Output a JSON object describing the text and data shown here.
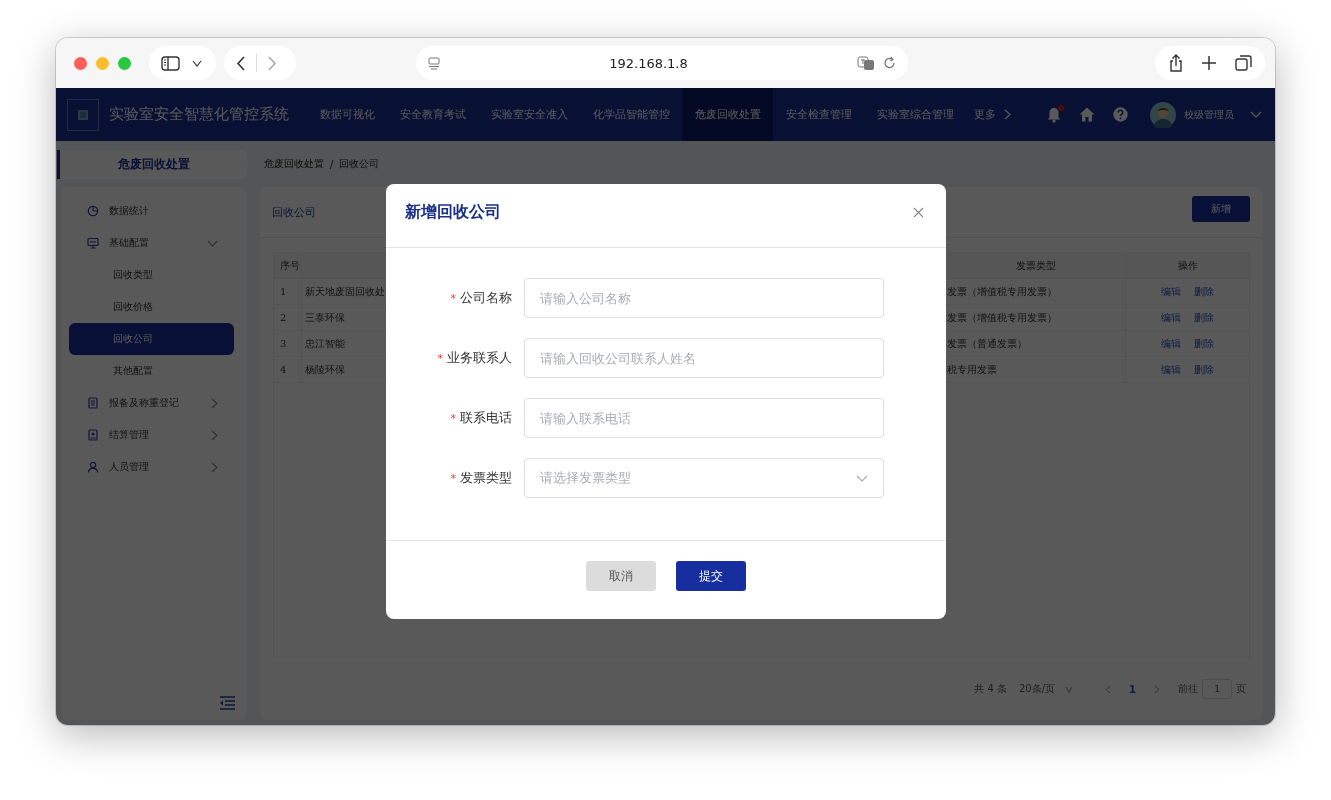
{
  "browser": {
    "address": "192.168.1.8"
  },
  "app": {
    "title": "实验室安全智慧化管控系统",
    "nav": [
      {
        "label": "数据可视化",
        "selected": false
      },
      {
        "label": "安全教育考试",
        "selected": false
      },
      {
        "label": "实验室安全准入",
        "selected": false
      },
      {
        "label": "化学品智能管控",
        "selected": false
      },
      {
        "label": "危废回收处置",
        "selected": true
      },
      {
        "label": "安全检查管理",
        "selected": false
      },
      {
        "label": "实验室综合管理",
        "selected": false
      }
    ],
    "more": "更多",
    "user": "校级管理员"
  },
  "sidebar": {
    "section_title": "危废回收处置",
    "items": [
      {
        "label": "数据统计"
      },
      {
        "label": "基础配置",
        "expanded": true,
        "children": [
          {
            "label": "回收类型",
            "selected": false
          },
          {
            "label": "回收价格",
            "selected": false
          },
          {
            "label": "回收公司",
            "selected": true
          },
          {
            "label": "其他配置",
            "selected": false
          }
        ]
      },
      {
        "label": "报备及称重登记",
        "expanded": false
      },
      {
        "label": "结算管理",
        "expanded": false
      },
      {
        "label": "人员管理",
        "expanded": false
      }
    ]
  },
  "breadcrumb": {
    "items": [
      "危废回收处置",
      "回收公司"
    ],
    "separator": "/"
  },
  "panel": {
    "title": "回收公司",
    "add_button": "新增",
    "table": {
      "header": {
        "index": "序号",
        "invoice_type": "发票类型",
        "actions": "操作"
      },
      "rows": [
        {
          "index": "1",
          "name": "新天地废固回收处",
          "invoice_type": "发票（增值税专用发票）",
          "actions": [
            "编辑",
            "删除"
          ]
        },
        {
          "index": "2",
          "name": "三泰环保",
          "invoice_type": "发票（增值税专用发票）",
          "actions": [
            "编辑",
            "删除"
          ]
        },
        {
          "index": "3",
          "name": "忠江智能",
          "invoice_type": "发票（普通发票）",
          "actions": [
            "编辑",
            "删除"
          ]
        },
        {
          "index": "4",
          "name": "杨陵环保",
          "invoice_type": "税专用发票",
          "actions": [
            "编辑",
            "删除"
          ]
        }
      ]
    },
    "pagination": {
      "total": "共 4 条",
      "page_size": "20条/页",
      "pages": [
        {
          "label": "1",
          "selected": true
        }
      ],
      "goto_label": "前往",
      "goto_value": "1",
      "goto_suffix": "页"
    }
  },
  "modal": {
    "title": "新增回收公司",
    "required_mark": "*",
    "fields": [
      {
        "kind": "text",
        "label": "公司名称",
        "required": true,
        "placeholder": "请输入公司名称"
      },
      {
        "kind": "text",
        "label": "业务联系人",
        "required": true,
        "placeholder": "请输入回收公司联系人姓名"
      },
      {
        "kind": "text",
        "label": "联系电话",
        "required": true,
        "placeholder": "请输入联系电话"
      },
      {
        "kind": "select",
        "label": "发票类型",
        "required": true,
        "placeholder": "请选择发票类型"
      }
    ],
    "buttons": [
      {
        "kind": "secondary",
        "label": "取消"
      },
      {
        "kind": "primary",
        "label": "提交"
      }
    ]
  }
}
